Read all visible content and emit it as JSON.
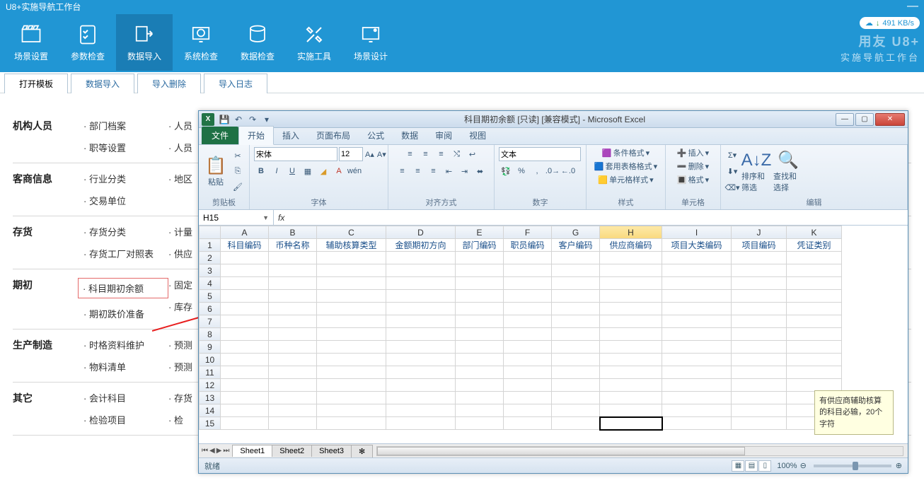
{
  "app": {
    "title": "U8+实施导航工作台",
    "minimize": "—"
  },
  "net": {
    "speed": "491 KB/s"
  },
  "brand": {
    "logo": "用友 U8+",
    "sub": "实施导航工作台"
  },
  "ribbon": [
    {
      "label": "场景设置"
    },
    {
      "label": "参数检查"
    },
    {
      "label": "数据导入"
    },
    {
      "label": "系统检查"
    },
    {
      "label": "数据检查"
    },
    {
      "label": "实施工具"
    },
    {
      "label": "场景设计"
    }
  ],
  "tabs": [
    {
      "label": "打开模板"
    },
    {
      "label": "数据导入"
    },
    {
      "label": "导入删除"
    },
    {
      "label": "导入日志"
    }
  ],
  "sections": {
    "org": {
      "title": "机构人员",
      "c1a": "部门档案",
      "c1b": "职等设置",
      "c2a": "人员",
      "c2b": "人员"
    },
    "cust": {
      "title": "客商信息",
      "c1a": "行业分类",
      "c1b": "交易单位",
      "c2a": "地区"
    },
    "inv": {
      "title": "存货",
      "c1a": "存货分类",
      "c1b": "存货工厂对照表",
      "c2a": "计量",
      "c2b": "供应"
    },
    "init": {
      "title": "期初",
      "c1a": "科目期初余额",
      "c1b": "期初跌价准备",
      "c2a": "固定",
      "c2b": "库存"
    },
    "mfg": {
      "title": "生产制造",
      "c1a": "时格资料维护",
      "c1b": "物料清单",
      "c2a": "预测",
      "c2b": "预测"
    },
    "other": {
      "title": "其它",
      "c1a": "会计科目",
      "c1b": "检验项目",
      "c2a": "存货",
      "c2b": "检"
    }
  },
  "excel": {
    "title": "科目期初余额 [只读] [兼容模式] - Microsoft Excel",
    "menus": {
      "file": "文件",
      "home": "开始",
      "insert": "插入",
      "layout": "页面布局",
      "formula": "公式",
      "data": "数据",
      "review": "审阅",
      "view": "视图"
    },
    "groups": {
      "clipboard": "剪贴板",
      "paste": "粘贴",
      "font": "字体",
      "align": "对齐方式",
      "number": "数字",
      "styles": "样式",
      "cells": "单元格",
      "editing": "编辑",
      "fontname": "宋体",
      "fontsize": "12",
      "numfmt": "文本",
      "cond": "条件格式",
      "tbl": "套用表格格式",
      "cell": "单元格样式",
      "ins": "插入",
      "del": "删除",
      "fmt": "格式",
      "sort": "排序和筛选",
      "find": "查找和选择"
    },
    "namebox": "H15",
    "columns": [
      "A",
      "B",
      "C",
      "D",
      "E",
      "F",
      "G",
      "H",
      "I",
      "J",
      "K"
    ],
    "headers": [
      "科目编码",
      "币种名称",
      "辅助核算类型",
      "金额期初方向",
      "部门编码",
      "职员编码",
      "客户编码",
      "供应商编码",
      "项目大类编码",
      "项目编码",
      "凭证类别"
    ],
    "rows": 15,
    "sheets": {
      "s1": "Sheet1",
      "s2": "Sheet2",
      "s3": "Sheet3"
    },
    "status": "就绪",
    "zoom": "100%",
    "tooltip": "有供应商辅助核算的科目必输，20个字符"
  }
}
